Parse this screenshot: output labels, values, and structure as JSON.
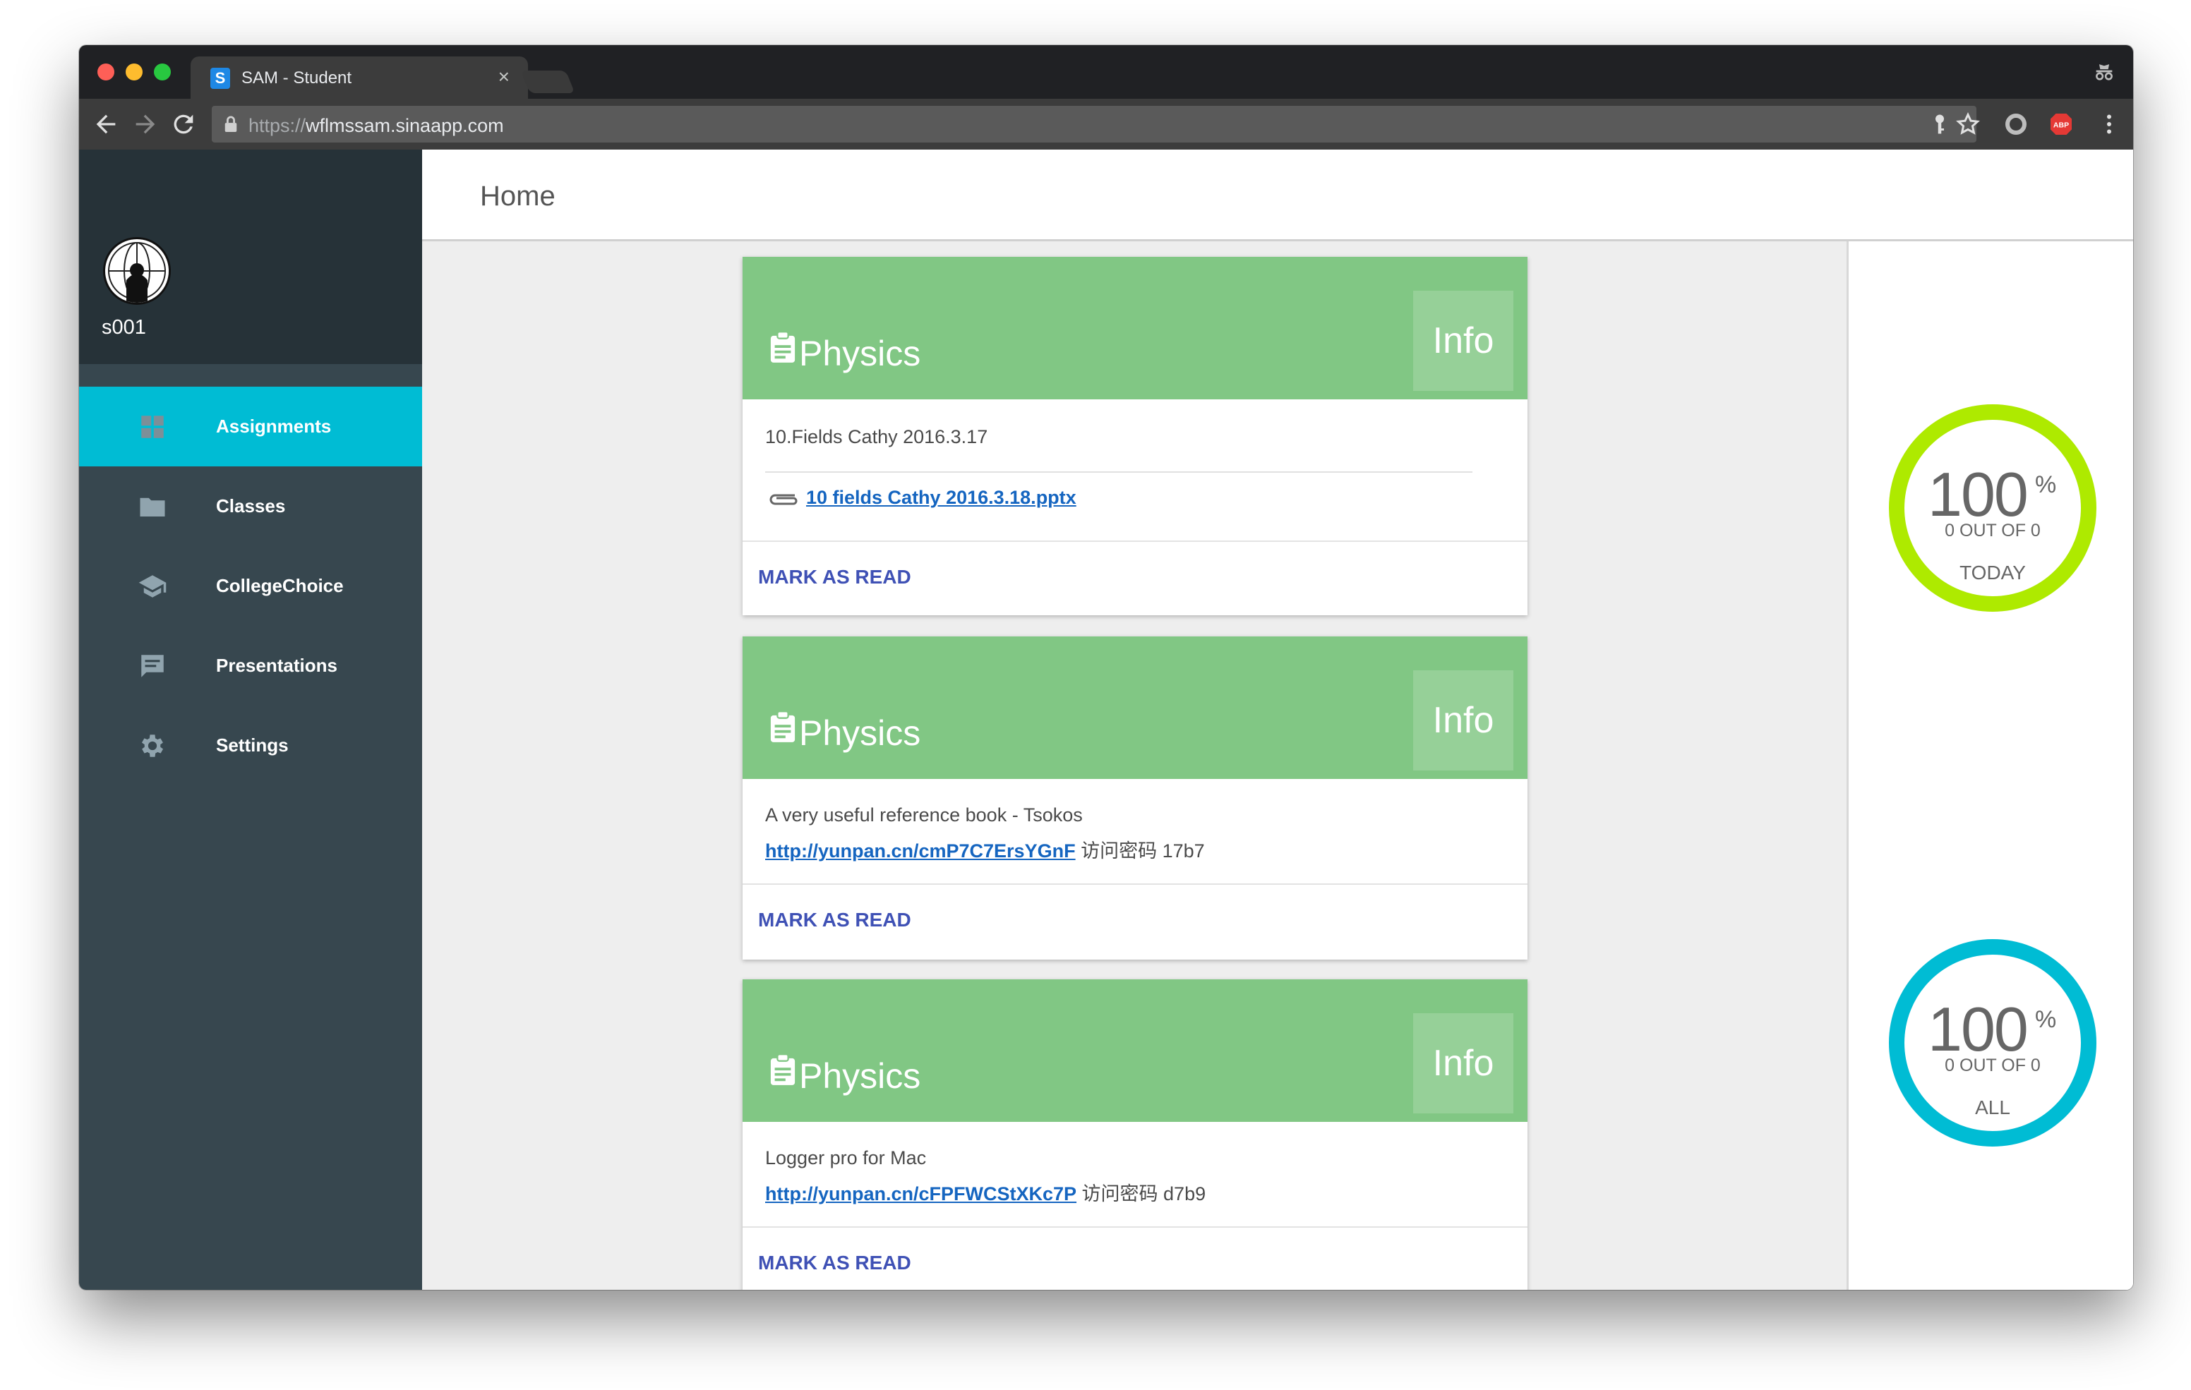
{
  "browser": {
    "tab_title": "SAM - Student",
    "tab_favicon": "S",
    "url_scheme": "https://",
    "url_host": "wflmssam.sinaapp.com"
  },
  "sidebar": {
    "username": "s001",
    "items": [
      {
        "label": "Assignments",
        "icon": "dashboard-icon",
        "active": true
      },
      {
        "label": "Classes",
        "icon": "folder-icon",
        "active": false
      },
      {
        "label": "CollegeChoice",
        "icon": "graduation-cap-icon",
        "active": false
      },
      {
        "label": "Presentations",
        "icon": "chat-bubble-icon",
        "active": false
      },
      {
        "label": "Settings",
        "icon": "gear-icon",
        "active": false
      }
    ]
  },
  "header": {
    "title": "Home"
  },
  "cards": [
    {
      "subject": "Physics",
      "badge": "Info",
      "text": "10.Fields Cathy 2016.3.17",
      "attachment": "10 fields Cathy 2016.3.18.pptx",
      "action": "MARK AS READ"
    },
    {
      "subject": "Physics",
      "badge": "Info",
      "text": "A very useful reference book - Tsokos",
      "link": "http://yunpan.cn/cmP7C7ErsYGnF",
      "link_suffix": " 访问密码 17b7",
      "action": "MARK AS READ"
    },
    {
      "subject": "Physics",
      "badge": "Info",
      "text": "Logger pro for Mac",
      "link": "http://yunpan.cn/cFPFWCStXKc7P",
      "link_suffix": " 访问密码 d7b9",
      "action": "MARK AS READ"
    }
  ],
  "stats": [
    {
      "percent": "100",
      "percent_sign": "%",
      "count": "0 OUT OF 0",
      "label": "TODAY",
      "progress": 1.0,
      "color": "#aeea00"
    },
    {
      "percent": "100",
      "percent_sign": "%",
      "count": "0 OUT OF 0",
      "label": "ALL",
      "progress": 1.0,
      "color": "#00bcd4"
    }
  ],
  "colors": {
    "sidebar": "#37474f",
    "sidebar_profile": "#263238",
    "active_item": "#00bcd4",
    "card_header": "#81c784",
    "action_text": "#3f51b5",
    "link": "#1565c0"
  }
}
